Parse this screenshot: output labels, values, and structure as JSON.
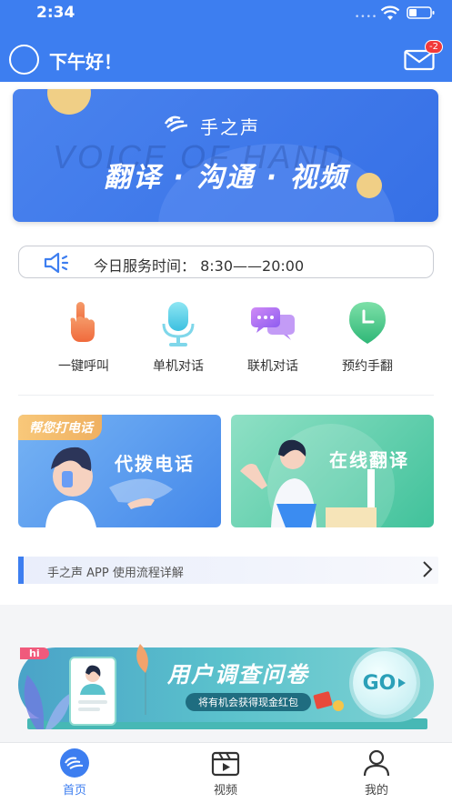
{
  "status_bar": {
    "time": "2:34",
    "signal": "••••"
  },
  "header": {
    "greeting": "下午好！",
    "mail_badge": "-2"
  },
  "banner": {
    "brand": "手之声",
    "watermark": "VOICE OF HAND",
    "slogan": "翻译 · 沟通 · 视频"
  },
  "service_time": {
    "text": "今日服务时间：  8:30——20:00"
  },
  "quick_actions": [
    {
      "label": "一键呼叫",
      "icon": "finger-tap-icon"
    },
    {
      "label": "单机对话",
      "icon": "microphone-icon"
    },
    {
      "label": "联机对话",
      "icon": "chat-bubbles-icon"
    },
    {
      "label": "预约手翻",
      "icon": "clock-pin-icon"
    }
  ],
  "cards": {
    "left": {
      "tag": "帮您打电话",
      "title": "代拨电话"
    },
    "right": {
      "title": "在线翻译"
    }
  },
  "process": {
    "text": "手之声 APP 使用流程详解"
  },
  "survey": {
    "hi": "hi",
    "title": "用户调查问卷",
    "subtitle": "将有机会获得现金红包",
    "go": "GO"
  },
  "tabs": [
    {
      "label": "首页",
      "icon": "home-logo-icon",
      "active": true
    },
    {
      "label": "视频",
      "icon": "video-clapper-icon",
      "active": false
    },
    {
      "label": "我的",
      "icon": "user-icon",
      "active": false
    }
  ],
  "colors": {
    "primary": "#3d7ef0",
    "badge": "#f23a3a"
  }
}
